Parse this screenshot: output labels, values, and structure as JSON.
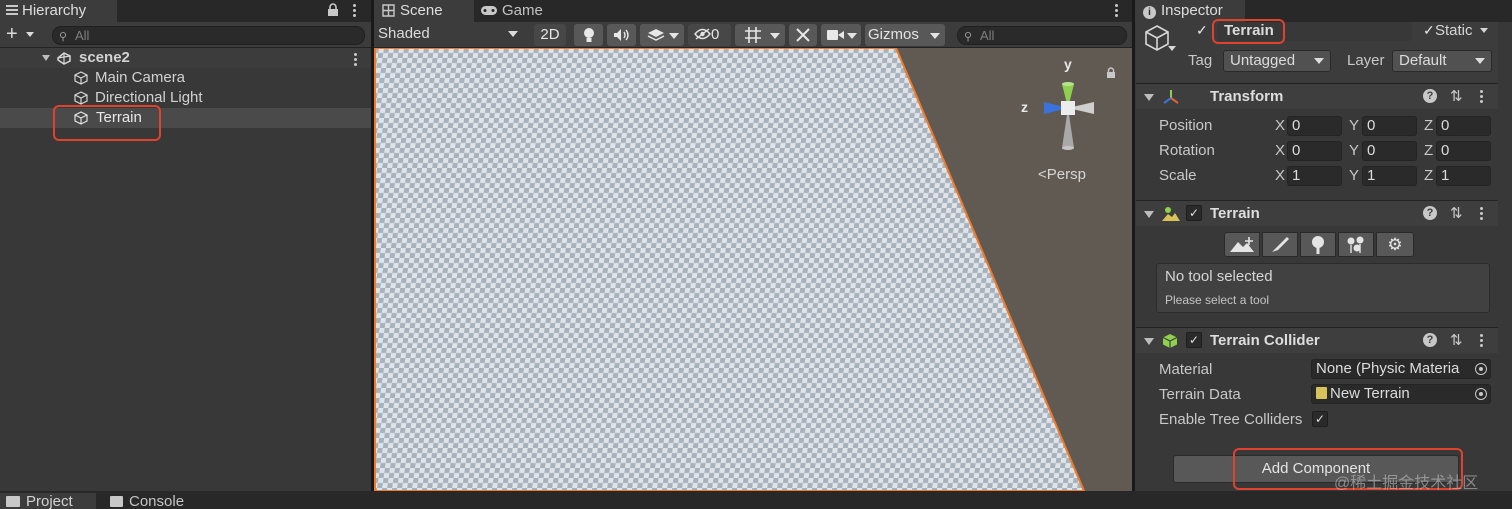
{
  "hierarchy": {
    "tab_label": "Hierarchy",
    "search_placeholder": "All",
    "scene_name": "scene2",
    "items": [
      {
        "label": "Main Camera"
      },
      {
        "label": "Directional Light"
      },
      {
        "label": "Terrain"
      }
    ]
  },
  "scene_view": {
    "tabs": [
      {
        "label": "Scene"
      },
      {
        "label": "Game"
      }
    ],
    "shading_mode": "Shaded",
    "mode_2d": "2D",
    "hidden_count": "0",
    "gizmos_label": "Gizmos",
    "search_placeholder": "All",
    "gizmo_axes": {
      "y": "y",
      "z": "z"
    },
    "projection_label": "Persp"
  },
  "inspector": {
    "tab_label": "Inspector",
    "object_name": "Terrain",
    "static_label": "Static",
    "tag_label": "Tag",
    "tag_value": "Untagged",
    "layer_label": "Layer",
    "layer_value": "Default",
    "transform": {
      "title": "Transform",
      "rows": [
        {
          "label": "Position",
          "x": "0",
          "y": "0",
          "z": "0"
        },
        {
          "label": "Rotation",
          "x": "0",
          "y": "0",
          "z": "0"
        },
        {
          "label": "Scale",
          "x": "1",
          "y": "1",
          "z": "1"
        }
      ],
      "axis_x": "X",
      "axis_y": "Y",
      "axis_z": "Z"
    },
    "terrain": {
      "title": "Terrain",
      "tool_status": "No tool selected",
      "tool_hint": "Please select a tool"
    },
    "terrain_collider": {
      "title": "Terrain Collider",
      "material_label": "Material",
      "material_value": "None (Physic Materia",
      "terrain_data_label": "Terrain Data",
      "terrain_data_value": "New Terrain",
      "tree_colliders_label": "Enable Tree Colliders"
    },
    "add_component_label": "Add Component"
  },
  "bottom_tabs": [
    {
      "label": "Project"
    },
    {
      "label": "Console"
    }
  ],
  "watermark": "@稀土掘金技术社区",
  "colors": {
    "highlight": "#e0422e",
    "selection_outline": "#f07a2a",
    "gizmo_y": "#8fd14f",
    "gizmo_z": "#3b72e0"
  }
}
